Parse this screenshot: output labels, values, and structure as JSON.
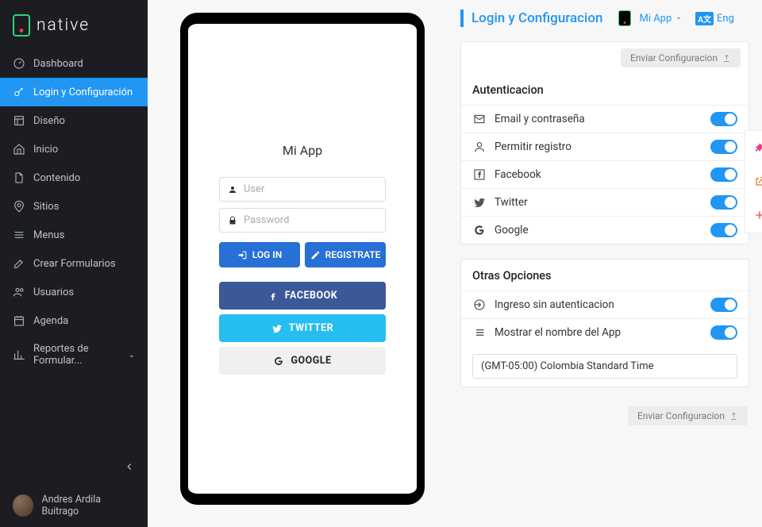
{
  "brand": "native",
  "nav": [
    {
      "label": "Dashboard",
      "icon": "gauge"
    },
    {
      "label": "Login y Configuración",
      "icon": "key",
      "active": true
    },
    {
      "label": "Diseño",
      "icon": "layout"
    },
    {
      "label": "Inicio",
      "icon": "home"
    },
    {
      "label": "Contenido",
      "icon": "file"
    },
    {
      "label": "Sitios",
      "icon": "pin"
    },
    {
      "label": "Menus",
      "icon": "menu"
    },
    {
      "label": "Crear Formularios",
      "icon": "edit"
    },
    {
      "label": "Usuarios",
      "icon": "users"
    },
    {
      "label": "Agenda",
      "icon": "calendar"
    },
    {
      "label": "Reportes de Formular...",
      "icon": "chart",
      "caret": true
    }
  ],
  "user_name": "Andres Ardila Buitrago",
  "phone": {
    "title": "Mi App",
    "user_ph": "User",
    "pass_ph": "Password",
    "login": "LOG IN",
    "register": "REGISTRATE",
    "fb": "FACEBOOK",
    "tw": "TWITTER",
    "gg": "GOOGLE"
  },
  "settings": {
    "title": "Login y Configuracion",
    "app_name": "Mi App",
    "lang_label": "Eng",
    "send": "Enviar Configuracion",
    "auth_title": "Autenticacion",
    "auth": [
      {
        "label": "Email y contraseña",
        "icon": "mail"
      },
      {
        "label": "Permitir registro",
        "icon": "person"
      },
      {
        "label": "Facebook",
        "icon": "fb"
      },
      {
        "label": "Twitter",
        "icon": "tw"
      },
      {
        "label": "Google",
        "icon": "gg"
      }
    ],
    "other_title": "Otras Opciones",
    "other": [
      {
        "label": "Ingreso sin autenticacion",
        "icon": "enter"
      },
      {
        "label": "Mostrar el nombre del App",
        "icon": "list"
      }
    ],
    "timezone": "(GMT-05:00) Colombia Standard Time"
  }
}
